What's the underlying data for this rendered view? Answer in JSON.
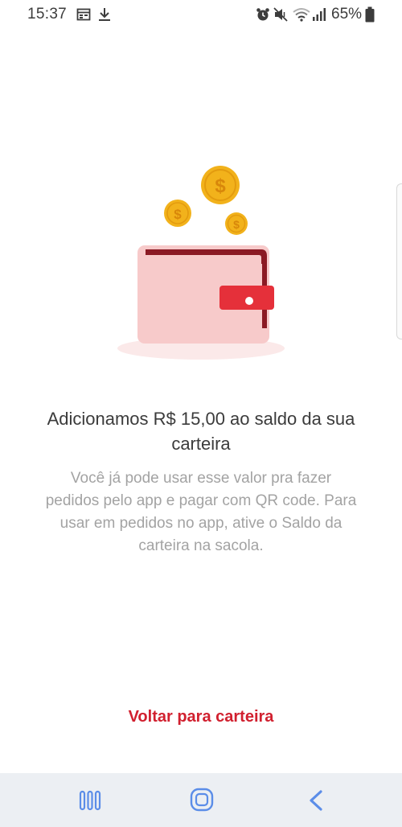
{
  "status_bar": {
    "time": "15:37",
    "battery": "65%",
    "icons": [
      "calendar-icon",
      "download-icon",
      "alarm-icon",
      "mute-icon",
      "wifi-icon",
      "signal-icon",
      "battery-icon"
    ]
  },
  "content": {
    "headline": "Adicionamos R$ 15,00 ao saldo da sua carteira",
    "body": "Você já pode usar esse valor pra fazer pedidos pelo app e pagar com QR code. Para usar em pedidos no app, ative o Saldo da carteira na sacola.",
    "back_link": "Voltar para carteira"
  },
  "illustration": {
    "icons": [
      "wallet-icon",
      "coin-icon"
    ],
    "coin_symbol": "$"
  },
  "colors": {
    "accent": "#d1202f",
    "wallet_body": "#f7caca",
    "wallet_top": "#8b1a24",
    "coin": "#f2b21b",
    "headline": "#3b3b3b",
    "body_text": "#a3a3a3",
    "nav_bg": "#eceff3",
    "nav_icon": "#5b8de8"
  },
  "nav_bar": {
    "icons": [
      "recent-apps-icon",
      "home-icon",
      "back-icon"
    ]
  }
}
